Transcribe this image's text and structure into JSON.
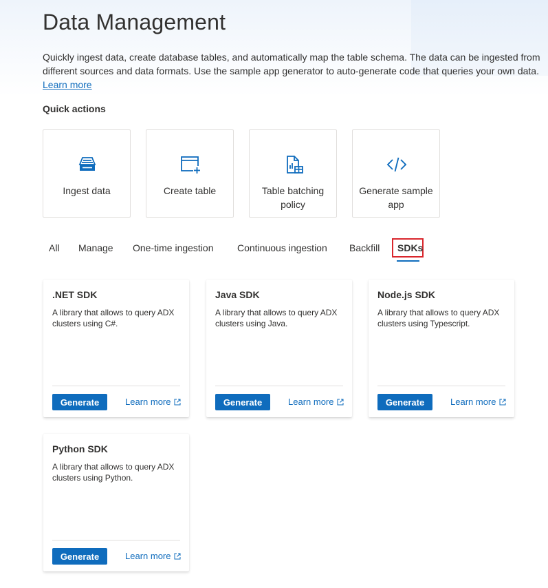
{
  "page": {
    "title": "Data Management",
    "description": "Quickly ingest data, create database tables, and automatically map the table schema. The data can be ingested from different sources and data formats. Use the sample app generator to auto-generate code that queries your own data.",
    "learn_more": "Learn more"
  },
  "quick_actions": {
    "title": "Quick actions",
    "items": [
      {
        "label": "Ingest data",
        "icon": "database-ingest-icon"
      },
      {
        "label": "Create table",
        "icon": "table-add-icon"
      },
      {
        "label": "Table batching policy",
        "icon": "document-chart-icon"
      },
      {
        "label": "Generate sample app",
        "icon": "code-icon"
      }
    ]
  },
  "tabs": {
    "items": [
      "All",
      "Manage",
      "One-time ingestion",
      "Continuous ingestion",
      "Backfill",
      "SDKs"
    ],
    "active": "SDKs"
  },
  "sdks": [
    {
      "title": ".NET SDK",
      "description": "A library that allows to query ADX clusters using C#.",
      "generate": "Generate",
      "learn_more": "Learn more"
    },
    {
      "title": "Java SDK",
      "description": "A library that allows to query ADX clusters using Java.",
      "generate": "Generate",
      "learn_more": "Learn more"
    },
    {
      "title": "Node.js SDK",
      "description": "A library that allows to query ADX clusters using Typescript.",
      "generate": "Generate",
      "learn_more": "Learn more"
    },
    {
      "title": "Python SDK",
      "description": "A library that allows to query ADX clusters using Python.",
      "generate": "Generate",
      "learn_more": "Learn more"
    }
  ],
  "colors": {
    "accent": "#0f6cbd",
    "highlight_border": "#d9262c",
    "text": "#323130"
  }
}
